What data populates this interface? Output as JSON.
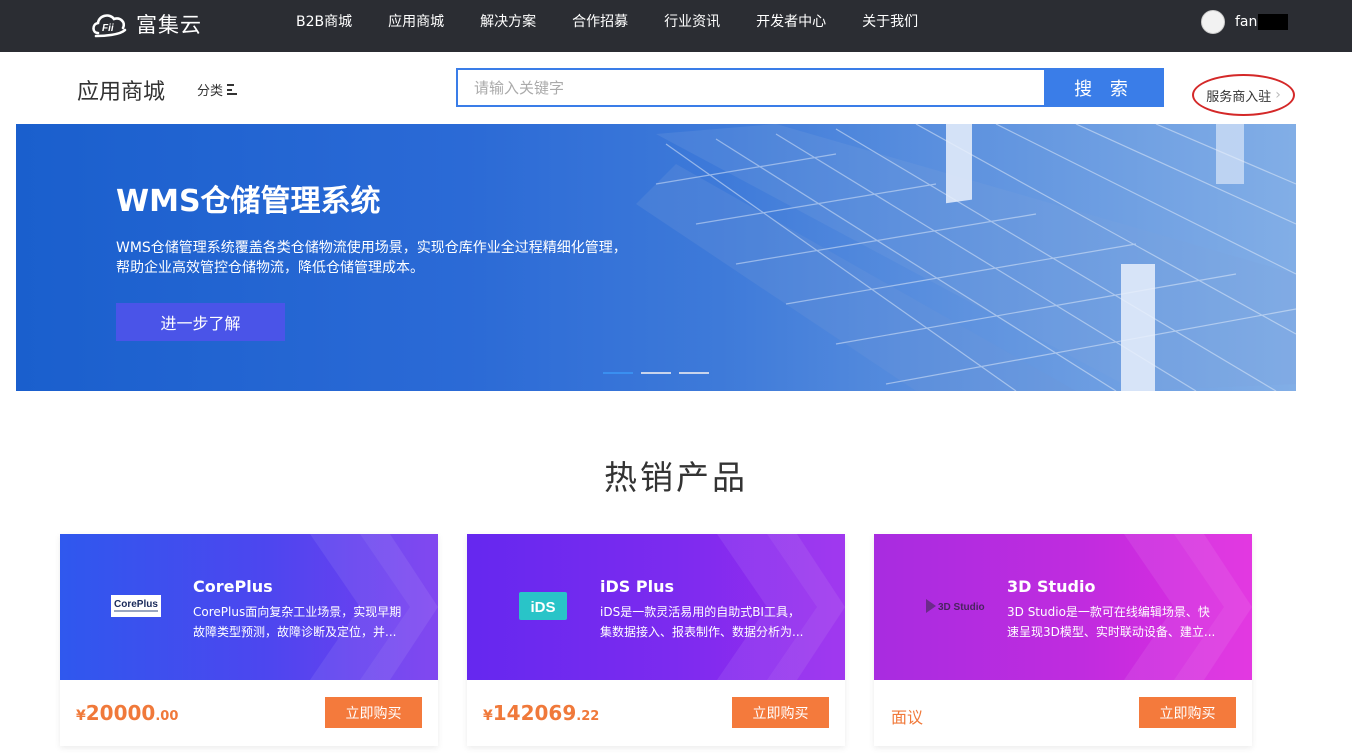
{
  "topbar": {
    "brand": "富集云",
    "nav": [
      "B2B商城",
      "应用商城",
      "解决方案",
      "合作招募",
      "行业资讯",
      "开发者中心",
      "关于我们"
    ],
    "username": "fan"
  },
  "header": {
    "title": "应用商城",
    "category_label": "分类",
    "search_placeholder": "请输入关键字",
    "search_button": "搜 索",
    "merchant_link": "服务商入驻"
  },
  "banner": {
    "title": "WMS仓储管理系统",
    "desc_line1": "WMS仓储管理系统覆盖各类仓储物流使用场景，实现仓库作业全过程精细化管理，",
    "desc_line2": "帮助企业高效管控仓储物流，降低仓储管理成本。",
    "button": "进一步了解",
    "active_slide": 1,
    "slide_count": 3
  },
  "hot": {
    "title": "热销产品",
    "products": [
      {
        "name": "CorePlus",
        "desc_line1": "CorePlus面向复杂工业场景，实现早期",
        "desc_line2": "故障类型预测，故障诊断及定位，并...",
        "logo_text": "CorePlus",
        "price_currency": "¥",
        "price_int": "20000",
        "price_dec": ".00",
        "buy": "立即购买",
        "gradient": [
          "#2f5ff0",
          "#7a3cf0"
        ]
      },
      {
        "name": "iDS Plus",
        "desc_line1": "iDS是一款灵活易用的自助式BI工具，",
        "desc_line2": "集数据接入、报表制作、数据分析为...",
        "logo_text": "iDS",
        "price_currency": "¥",
        "price_int": "142069",
        "price_dec": ".22",
        "buy": "立即购买",
        "gradient": [
          "#6a2cf0",
          "#9b2cee"
        ]
      },
      {
        "name": "3D Studio",
        "desc_line1": "3D Studio是一款可在线编辑场景、快",
        "desc_line2": "速呈现3D模型、实时联动设备、建立...",
        "logo_text": "3D Studio",
        "price_text": "面议",
        "buy": "立即购买",
        "gradient": [
          "#b12cdf",
          "#e22ce0"
        ]
      }
    ]
  }
}
